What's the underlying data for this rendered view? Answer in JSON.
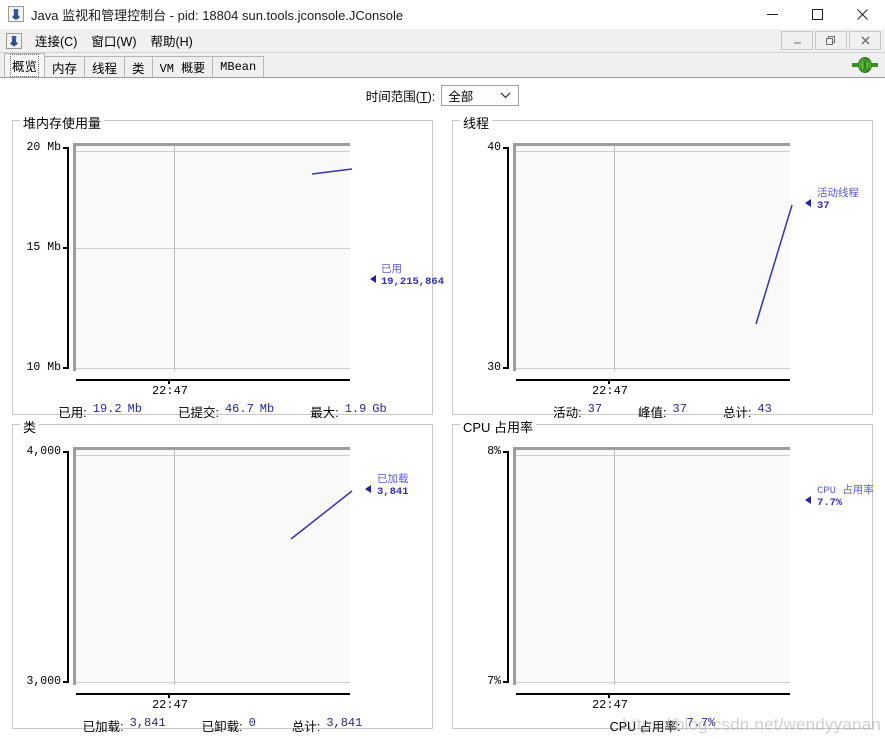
{
  "window": {
    "title": "Java 监视和管理控制台 - pid: 18804 sun.tools.jconsole.JConsole",
    "minimize_label": "—",
    "maximize_label": "□",
    "close_label": "✕"
  },
  "menubar": {
    "items": [
      {
        "label": "连接(C)",
        "mnemonic": "C",
        "text": "连接"
      },
      {
        "label": "窗口(W)",
        "mnemonic": "W",
        "text": "窗口"
      },
      {
        "label": "帮助(H)",
        "mnemonic": "H",
        "text": "帮助"
      }
    ],
    "mdi": {
      "minimize": "_",
      "restore": "❐",
      "close": "✕"
    }
  },
  "tabs": [
    {
      "label": "概览",
      "selected": true
    },
    {
      "label": "内存",
      "selected": false
    },
    {
      "label": "线程",
      "selected": false
    },
    {
      "label": "类",
      "selected": false
    },
    {
      "label": "VM 概要",
      "selected": false
    },
    {
      "label": "MBean",
      "selected": false
    }
  ],
  "connection_status_icon": "green-plug-connected-icon",
  "timerange": {
    "label_text": "时间范围",
    "label_mnemonic": "T",
    "label_suffix": ":",
    "value": "全部"
  },
  "panels": {
    "heap": {
      "title": "堆内存使用量",
      "y_ticks": [
        "20 Mb",
        "15 Mb",
        "10 Mb"
      ],
      "x_tick": "22:47",
      "legend_name": "已用",
      "legend_value": "19,215,864",
      "stats": [
        {
          "label": "已用:",
          "value": "19.2",
          "unit": "Mb"
        },
        {
          "label": "已提交:",
          "value": "46.7",
          "unit": "Mb"
        },
        {
          "label": "最大:",
          "value": "1.9",
          "unit": "Gb"
        }
      ]
    },
    "threads": {
      "title": "线程",
      "y_ticks": [
        "40",
        "30"
      ],
      "x_tick": "22:47",
      "legend_name": "活动线程",
      "legend_value": "37",
      "stats": [
        {
          "label": "活动:",
          "value": "37",
          "unit": ""
        },
        {
          "label": "峰值:",
          "value": "37",
          "unit": ""
        },
        {
          "label": "总计:",
          "value": "43",
          "unit": ""
        }
      ]
    },
    "classes": {
      "title": "类",
      "y_ticks": [
        "4,000",
        "3,000"
      ],
      "x_tick": "22:47",
      "legend_name": "已加载",
      "legend_value": "3,841",
      "stats": [
        {
          "label": "已加载:",
          "value": "3,841",
          "unit": ""
        },
        {
          "label": "已卸载:",
          "value": "0",
          "unit": ""
        },
        {
          "label": "总计:",
          "value": "3,841",
          "unit": ""
        }
      ]
    },
    "cpu": {
      "title": "CPU 占用率",
      "y_ticks": [
        "8%",
        "7%"
      ],
      "x_tick": "22:47",
      "legend_name": "CPU 占用率",
      "legend_value": "7.7%",
      "stats": [
        {
          "label": "CPU 占用率:",
          "value": "7.7%",
          "unit": ""
        }
      ]
    }
  },
  "watermark": "https://blog.csdn.net/wendyyanan",
  "colors": {
    "series": "#3333bb",
    "legend_name": "#5a5ad8",
    "stat_value": "#26269c",
    "plot_bg": "#f9f9f9",
    "panel_border": "#c8c8c8",
    "connected": "#4ca832"
  },
  "chart_data": [
    {
      "type": "line",
      "title": "堆内存使用量",
      "ylabel": "",
      "xlabel": "",
      "ylim": [
        10,
        20
      ],
      "yticks": [
        10,
        15,
        20
      ],
      "ytick_labels": [
        "10 Mb",
        "15 Mb",
        "20 Mb"
      ],
      "xtick_labels": [
        "22:47"
      ],
      "grid": true,
      "legend_position": "right-outside",
      "series": [
        {
          "name": "已用",
          "current_value": 19215864,
          "display_value": "19,215,864",
          "x": [
            0.82,
            0.92,
            1.0
          ],
          "values": [
            18.9,
            19.1,
            19.2
          ]
        }
      ]
    },
    {
      "type": "line",
      "title": "线程",
      "ylabel": "",
      "xlabel": "",
      "ylim": [
        30,
        40
      ],
      "yticks": [
        30,
        40
      ],
      "ytick_labels": [
        "30",
        "40"
      ],
      "xtick_labels": [
        "22:47"
      ],
      "grid": true,
      "legend_position": "right-outside",
      "series": [
        {
          "name": "活动线程",
          "current_value": 37,
          "display_value": "37",
          "x": [
            0.86,
            1.0
          ],
          "values": [
            31.0,
            37.0
          ]
        }
      ]
    },
    {
      "type": "line",
      "title": "类",
      "ylabel": "",
      "xlabel": "",
      "ylim": [
        3000,
        4000
      ],
      "yticks": [
        3000,
        4000
      ],
      "ytick_labels": [
        "3,000",
        "4,000"
      ],
      "xtick_labels": [
        "22:47"
      ],
      "grid": true,
      "legend_position": "right-outside",
      "series": [
        {
          "name": "已加载",
          "current_value": 3841,
          "display_value": "3,841",
          "x": [
            0.86,
            1.0
          ],
          "values": [
            3760,
            3841
          ]
        }
      ]
    },
    {
      "type": "line",
      "title": "CPU 占用率",
      "ylabel": "",
      "xlabel": "",
      "ylim": [
        7,
        8
      ],
      "yticks": [
        7,
        8
      ],
      "ytick_labels": [
        "7%",
        "8%"
      ],
      "xtick_labels": [
        "22:47"
      ],
      "grid": true,
      "legend_position": "right-outside",
      "series": [
        {
          "name": "CPU 占用率",
          "current_value": 7.7,
          "display_value": "7.7%",
          "x": [],
          "values": []
        }
      ]
    }
  ]
}
